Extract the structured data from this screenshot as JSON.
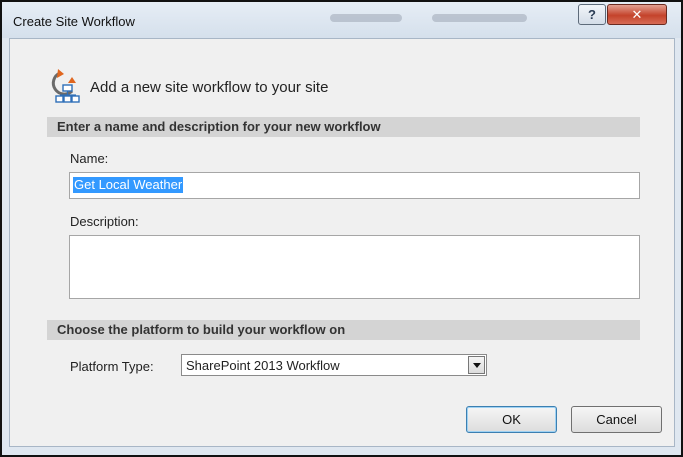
{
  "window": {
    "title": "Create Site Workflow",
    "help_label": "?",
    "close_label": "✕"
  },
  "header": {
    "text": "Add a new site workflow to your site",
    "icon": "workflow-icon"
  },
  "section_name": {
    "heading": "Enter a name and description for your new workflow",
    "name_label": "Name:",
    "name_value": "Get Local Weather",
    "description_label": "Description:",
    "description_value": ""
  },
  "section_platform": {
    "heading": "Choose the platform to build your workflow on",
    "platform_label": "Platform Type:",
    "platform_value": "SharePoint 2013 Workflow"
  },
  "buttons": {
    "ok": "OK",
    "cancel": "Cancel"
  },
  "colors": {
    "selection": "#3399ff",
    "section_bar": "#d4d4d4",
    "dialog_bg": "#f0f0f0",
    "close_button": "#c4432b"
  }
}
